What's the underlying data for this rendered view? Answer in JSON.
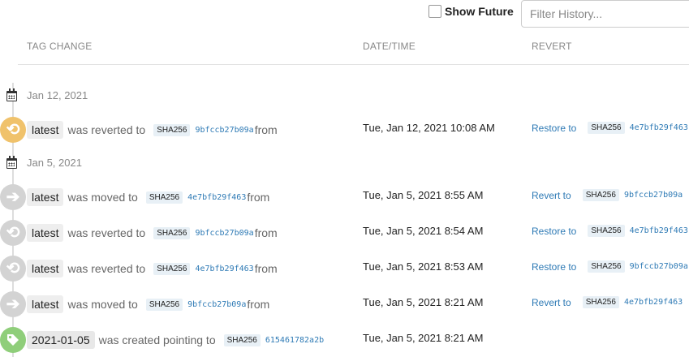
{
  "toolbar": {
    "show_future_label": "Show Future",
    "filter_placeholder": "Filter History..."
  },
  "header": {
    "tag_change": "TAG CHANGE",
    "date_time": "DATE/TIME",
    "revert": "REVERT"
  },
  "days": [
    {
      "label": "Jan 12, 2021"
    },
    {
      "label": "Jan 5, 2021"
    }
  ],
  "rows": [
    {
      "icon": "revert-icon",
      "tag": "latest",
      "verb": "was reverted to",
      "sha_label": "SHA256",
      "sha": "9bfccb27b09a",
      "from": "from",
      "datetime": "Tue, Jan 12, 2021 10:08 AM",
      "action": "Restore to",
      "action_sha_label": "SHA256",
      "action_sha": "4e7bfb29f463"
    },
    {
      "icon": "arrow-right-icon",
      "tag": "latest",
      "verb": "was moved to",
      "sha_label": "SHA256",
      "sha": "4e7bfb29f463",
      "from": "from",
      "datetime": "Tue, Jan 5, 2021 8:55 AM",
      "action": "Revert to",
      "action_sha_label": "SHA256",
      "action_sha": "9bfccb27b09a"
    },
    {
      "icon": "revert-icon",
      "tag": "latest",
      "verb": "was reverted to",
      "sha_label": "SHA256",
      "sha": "9bfccb27b09a",
      "from": "from",
      "datetime": "Tue, Jan 5, 2021 8:54 AM",
      "action": "Restore to",
      "action_sha_label": "SHA256",
      "action_sha": "4e7bfb29f463"
    },
    {
      "icon": "revert-icon",
      "tag": "latest",
      "verb": "was reverted to",
      "sha_label": "SHA256",
      "sha": "4e7bfb29f463",
      "from": "from",
      "datetime": "Tue, Jan 5, 2021 8:53 AM",
      "action": "Restore to",
      "action_sha_label": "SHA256",
      "action_sha": "9bfccb27b09a"
    },
    {
      "icon": "arrow-right-icon",
      "tag": "latest",
      "verb": "was moved to",
      "sha_label": "SHA256",
      "sha": "9bfccb27b09a",
      "from": "from",
      "datetime": "Tue, Jan 5, 2021 8:21 AM",
      "action": "Revert to",
      "action_sha_label": "SHA256",
      "action_sha": "4e7bfb29f463"
    },
    {
      "icon": "tag-icon",
      "tag": "2021-01-05",
      "verb": "was created pointing to",
      "sha_label": "SHA256",
      "sha": "615461782a2b",
      "datetime": "Tue, Jan 5, 2021 8:21 AM"
    }
  ],
  "colors": {
    "link": "#2e7ab5",
    "icon_grey": "#d3d3d3",
    "icon_orange": "#f0c26b",
    "icon_green": "#8fce7a"
  }
}
